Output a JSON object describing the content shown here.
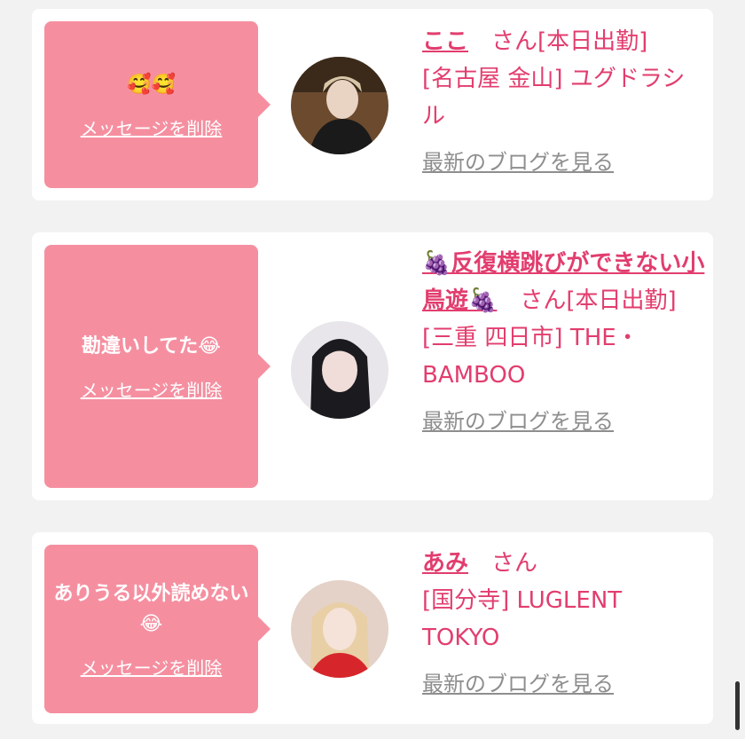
{
  "cards": [
    {
      "message": "🥰🥰",
      "delete_label": "メッセージを削除",
      "name": "ここ",
      "suffix": "　さん[本日出勤]",
      "shop": "[名古屋 金山] ユグドラシル",
      "blog_label": "最新のブログを見る"
    },
    {
      "message": "勘違いしてた😂",
      "delete_label": "メッセージを削除",
      "name": "🍇反復横跳びができない小鳥遊🍇",
      "suffix": "　さん[本日出勤]",
      "shop": "[三重 四日市] THE・BAMBOO",
      "blog_label": "最新のブログを見る"
    },
    {
      "message": "ありうる以外読めない😂",
      "delete_label": "メッセージを削除",
      "name": "あみ",
      "suffix": "　さん",
      "shop": "[国分寺] LUGLENT TOKYO",
      "blog_label": "最新のブログを見る"
    }
  ],
  "colors": {
    "bubble": "#f58fa0",
    "accent": "#e23d6e",
    "link_gray": "#8e8e8e",
    "background": "#f2f2f2"
  }
}
